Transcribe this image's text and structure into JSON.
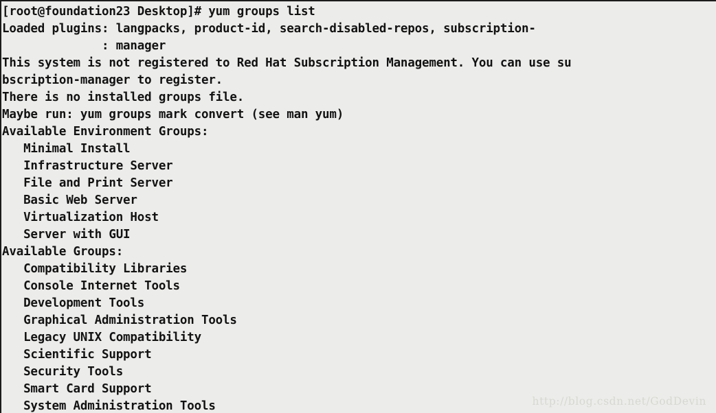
{
  "terminal": {
    "background_color": "#ececea",
    "text_color": "#121212",
    "prompt": "[root@foundation23 Desktop]#",
    "command": "yum groups list",
    "lines": [
      "[root@foundation23 Desktop]# yum groups list",
      "Loaded plugins: langpacks, product-id, search-disabled-repos, subscription-",
      "              : manager",
      "This system is not registered to Red Hat Subscription Management. You can use su",
      "bscription-manager to register.",
      "There is no installed groups file.",
      "Maybe run: yum groups mark convert (see man yum)",
      "Available Environment Groups:",
      "   Minimal Install",
      "   Infrastructure Server",
      "   File and Print Server",
      "   Basic Web Server",
      "   Virtualization Host",
      "   Server with GUI",
      "Available Groups:",
      "   Compatibility Libraries",
      "   Console Internet Tools",
      "   Development Tools",
      "   Graphical Administration Tools",
      "   Legacy UNIX Compatibility",
      "   Scientific Support",
      "   Security Tools",
      "   Smart Card Support",
      "   System Administration Tools"
    ],
    "sections": {
      "loaded_plugins_label": "Loaded plugins:",
      "plugins": [
        "langpacks",
        "product-id",
        "search-disabled-repos",
        "subscription-manager"
      ],
      "messages": [
        "This system is not registered to Red Hat Subscription Management. You can use subscription-manager to register.",
        "There is no installed groups file.",
        "Maybe run: yum groups mark convert (see man yum)"
      ],
      "available_environment_groups_header": "Available Environment Groups:",
      "available_environment_groups": [
        "Minimal Install",
        "Infrastructure Server",
        "File and Print Server",
        "Basic Web Server",
        "Virtualization Host",
        "Server with GUI"
      ],
      "available_groups_header": "Available Groups:",
      "available_groups": [
        "Compatibility Libraries",
        "Console Internet Tools",
        "Development Tools",
        "Graphical Administration Tools",
        "Legacy UNIX Compatibility",
        "Scientific Support",
        "Security Tools",
        "Smart Card Support",
        "System Administration Tools"
      ]
    }
  },
  "watermark": {
    "text": "http://blog.csdn.net/GodDevin",
    "color": "#d7d7d2"
  }
}
